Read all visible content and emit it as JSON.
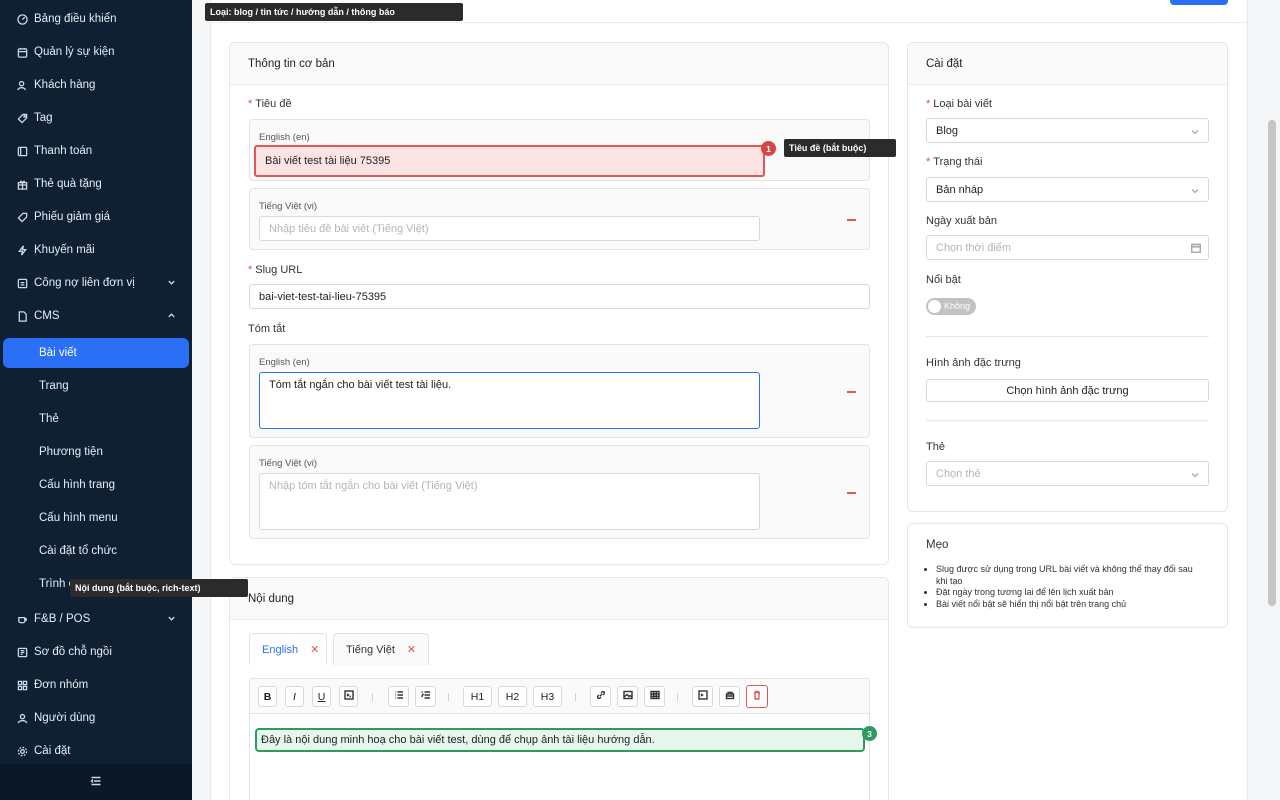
{
  "sidebar": {
    "items": [
      {
        "label": "Bảng điều khiển",
        "icon": "dashboard-icon"
      },
      {
        "label": "Quản lý sự kiện",
        "icon": "calendar-icon"
      },
      {
        "label": "Khách hàng",
        "icon": "user-icon"
      },
      {
        "label": "Tag",
        "icon": "tag-icon"
      },
      {
        "label": "Thanh toán",
        "icon": "payment-icon"
      },
      {
        "label": "Thẻ quà tặng",
        "icon": "gift-icon"
      },
      {
        "label": "Phiếu giảm giá",
        "icon": "coupon-icon"
      },
      {
        "label": "Khuyến mãi",
        "icon": "lightning-icon"
      },
      {
        "label": "Công nợ liên đơn vị",
        "icon": "debt-icon"
      },
      {
        "label": "CMS",
        "icon": "file-icon"
      }
    ],
    "cms_sub": [
      "Bài viết",
      "Trang",
      "Thẻ",
      "Phương tiện",
      "Cấu hình trang",
      "Cấu hình menu",
      "Cài đặt tổ chức",
      "Trình c"
    ],
    "bottom_items": [
      {
        "label": "F&B / POS",
        "icon": "coffee-icon"
      },
      {
        "label": "Sơ đồ chỗ ngồi",
        "icon": "seat-map-icon"
      },
      {
        "label": "Đơn nhóm",
        "icon": "grid-icon"
      },
      {
        "label": "Người dùng",
        "icon": "person-icon"
      },
      {
        "label": "Cài đặt",
        "icon": "gear-icon"
      }
    ]
  },
  "tooltips": {
    "top": "Loại: blog / tin tức / hướng dẫn / thông báo",
    "title": "Tiêu đề (bắt buộc)",
    "content": "Nội dung (bắt buộc, rich-text)"
  },
  "badges": {
    "title": "1",
    "content": "3"
  },
  "basic": {
    "header": "Thông tin cơ bản",
    "title_label": "Tiêu đề",
    "en_label": "English (en)",
    "vi_label": "Tiếng Việt (vi)",
    "title_en_value": "Bài viết test tài liệu 75395",
    "title_vi_placeholder": "Nhập tiêu đề bài viết (Tiếng Việt)",
    "slug_label": "Slug URL",
    "slug_value": "bai-viet-test-tai-lieu-75395",
    "summary_label": "Tóm tắt",
    "summary_en_value": "Tóm tắt ngắn cho bài viết test tài liệu.",
    "summary_vi_placeholder": "Nhập tóm tắt ngắn cho bài viết (Tiếng Việt)"
  },
  "content": {
    "header": "Nội dung",
    "tabs": [
      {
        "label": "English"
      },
      {
        "label": "Tiếng Việt"
      }
    ],
    "tab_close": "✕",
    "toolbar": {
      "b": "B",
      "i": "I",
      "u": "U",
      "h1": "H1",
      "h2": "H2",
      "h3": "H3"
    },
    "editor_text": "Đây là nội dung minh hoạ cho bài viết test, dùng để chụp ảnh tài liệu hướng dẫn."
  },
  "settings": {
    "header": "Cài đặt",
    "type_label": "Loại bài viết",
    "type_value": "Blog",
    "status_label": "Trạng thái",
    "status_value": "Bản nháp",
    "publish_label": "Ngày xuất bản",
    "publish_placeholder": "Chọn thời điểm",
    "featured_label": "Nổi bật",
    "featured_toggle": "Không",
    "featured_on": false,
    "image_label": "Hình ảnh đặc trưng",
    "image_button": "Chọn hình ảnh đặc trưng",
    "tags_label": "Thẻ",
    "tags_placeholder": "Chọn thẻ"
  },
  "tips": {
    "header": "Mẹo",
    "items": [
      "Slug được sử dụng trong URL bài viết và không thể thay đổi sau khi tạo",
      "Đặt ngày trong tương lai để lên lịch xuất bản",
      "Bài viết nổi bật sẽ hiển thị nổi bật trên trang chủ"
    ]
  },
  "colors": {
    "accent": "#2a6ff5",
    "sidebar": "#0f2033",
    "error": "#e05757",
    "success": "#2e9a5e"
  }
}
